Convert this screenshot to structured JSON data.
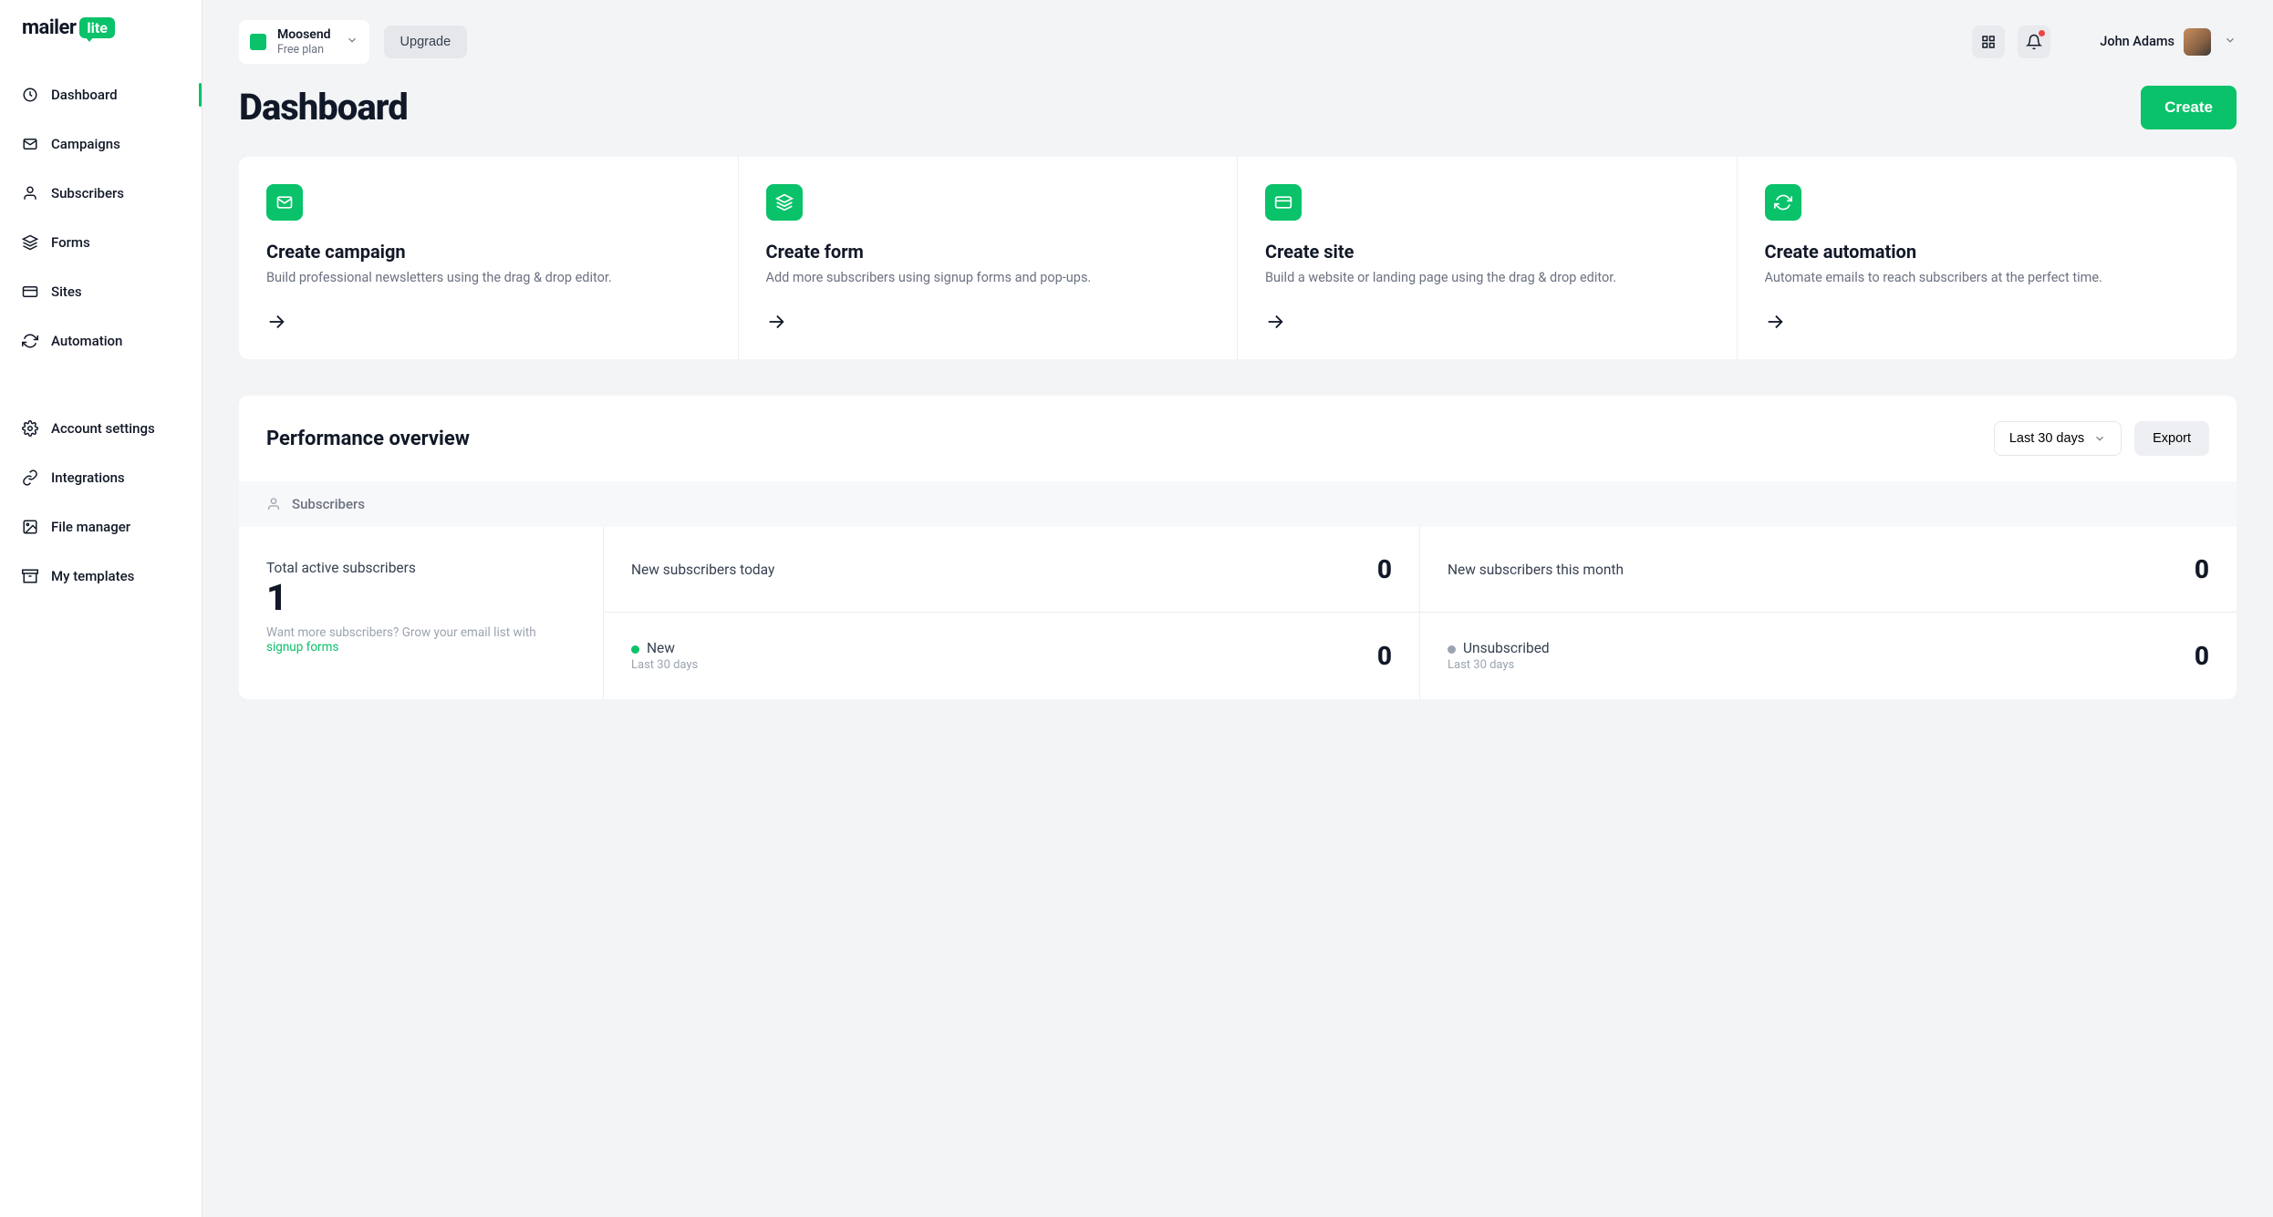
{
  "brand": {
    "name": "mailer",
    "badge": "lite"
  },
  "sidebar": {
    "primary": [
      {
        "id": "dashboard",
        "label": "Dashboard",
        "icon": "clock",
        "active": true
      },
      {
        "id": "campaigns",
        "label": "Campaigns",
        "icon": "mail",
        "active": false
      },
      {
        "id": "subscribers",
        "label": "Subscribers",
        "icon": "user",
        "active": false
      },
      {
        "id": "forms",
        "label": "Forms",
        "icon": "layers",
        "active": false
      },
      {
        "id": "sites",
        "label": "Sites",
        "icon": "card",
        "active": false
      },
      {
        "id": "automation",
        "label": "Automation",
        "icon": "refresh",
        "active": false
      }
    ],
    "secondary": [
      {
        "id": "account-settings",
        "label": "Account settings",
        "icon": "gear"
      },
      {
        "id": "integrations",
        "label": "Integrations",
        "icon": "link"
      },
      {
        "id": "file-manager",
        "label": "File manager",
        "icon": "image"
      },
      {
        "id": "my-templates",
        "label": "My templates",
        "icon": "box"
      }
    ]
  },
  "topbar": {
    "account_name": "Moosend",
    "account_plan": "Free plan",
    "upgrade_label": "Upgrade",
    "user_name": "John Adams"
  },
  "page": {
    "title": "Dashboard",
    "create_label": "Create"
  },
  "action_cards": [
    {
      "title": "Create campaign",
      "desc": "Build professional newsletters using the drag & drop editor.",
      "icon": "mail"
    },
    {
      "title": "Create form",
      "desc": "Add more subscribers using signup forms and pop-ups.",
      "icon": "layers"
    },
    {
      "title": "Create site",
      "desc": "Build a website or landing page using the drag & drop editor.",
      "icon": "card"
    },
    {
      "title": "Create automation",
      "desc": "Automate emails to reach subscribers at the perfect time.",
      "icon": "refresh"
    }
  ],
  "performance": {
    "title": "Performance overview",
    "range_label": "Last 30 days",
    "export_label": "Export",
    "section_label": "Subscribers",
    "total_label": "Total active subscribers",
    "total_value": "1",
    "hint_prefix": "Want more subscribers? ",
    "hint_middle": "Grow your email list with ",
    "hint_link": "signup forms",
    "stats": [
      {
        "label": "New subscribers today",
        "sub": "",
        "value": "0",
        "dot": ""
      },
      {
        "label": "New subscribers this month",
        "sub": "",
        "value": "0",
        "dot": ""
      },
      {
        "label": "New",
        "sub": "Last 30 days",
        "value": "0",
        "dot": "#09c269"
      },
      {
        "label": "Unsubscribed",
        "sub": "Last 30 days",
        "value": "0",
        "dot": "#9ca3af"
      }
    ]
  },
  "colors": {
    "accent": "#09c269"
  }
}
